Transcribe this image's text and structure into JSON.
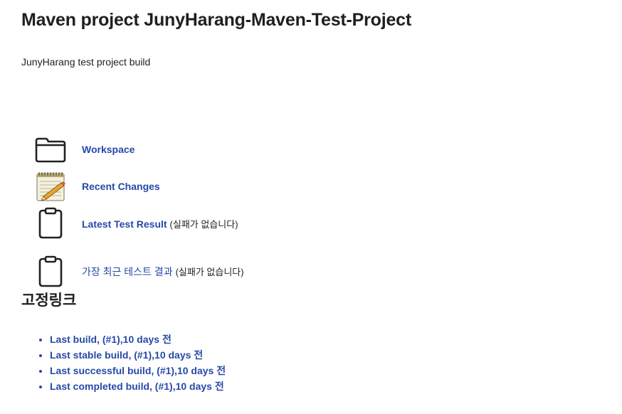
{
  "header": {
    "title": "Maven project JunyHarang-Maven-Test-Project",
    "description": "JunyHarang test project build"
  },
  "main_links": [
    {
      "label": "Workspace",
      "icon": "folder-icon",
      "suffix": ""
    },
    {
      "label": "Recent Changes",
      "icon": "notepad-icon",
      "suffix": ""
    },
    {
      "label": "Latest Test Result",
      "icon": "clipboard-icon",
      "suffix": "(실패가 없습니다)"
    },
    {
      "label": "가장 최근 테스트 결과",
      "icon": "clipboard-icon",
      "suffix": "(실패가 없습니다)"
    }
  ],
  "permalinks": {
    "title": "고정링크",
    "items": [
      "Last build, (#1),10 days 전",
      "Last stable build, (#1),10 days 전",
      "Last successful build, (#1),10 days 전",
      "Last completed build, (#1),10 days 전"
    ]
  }
}
